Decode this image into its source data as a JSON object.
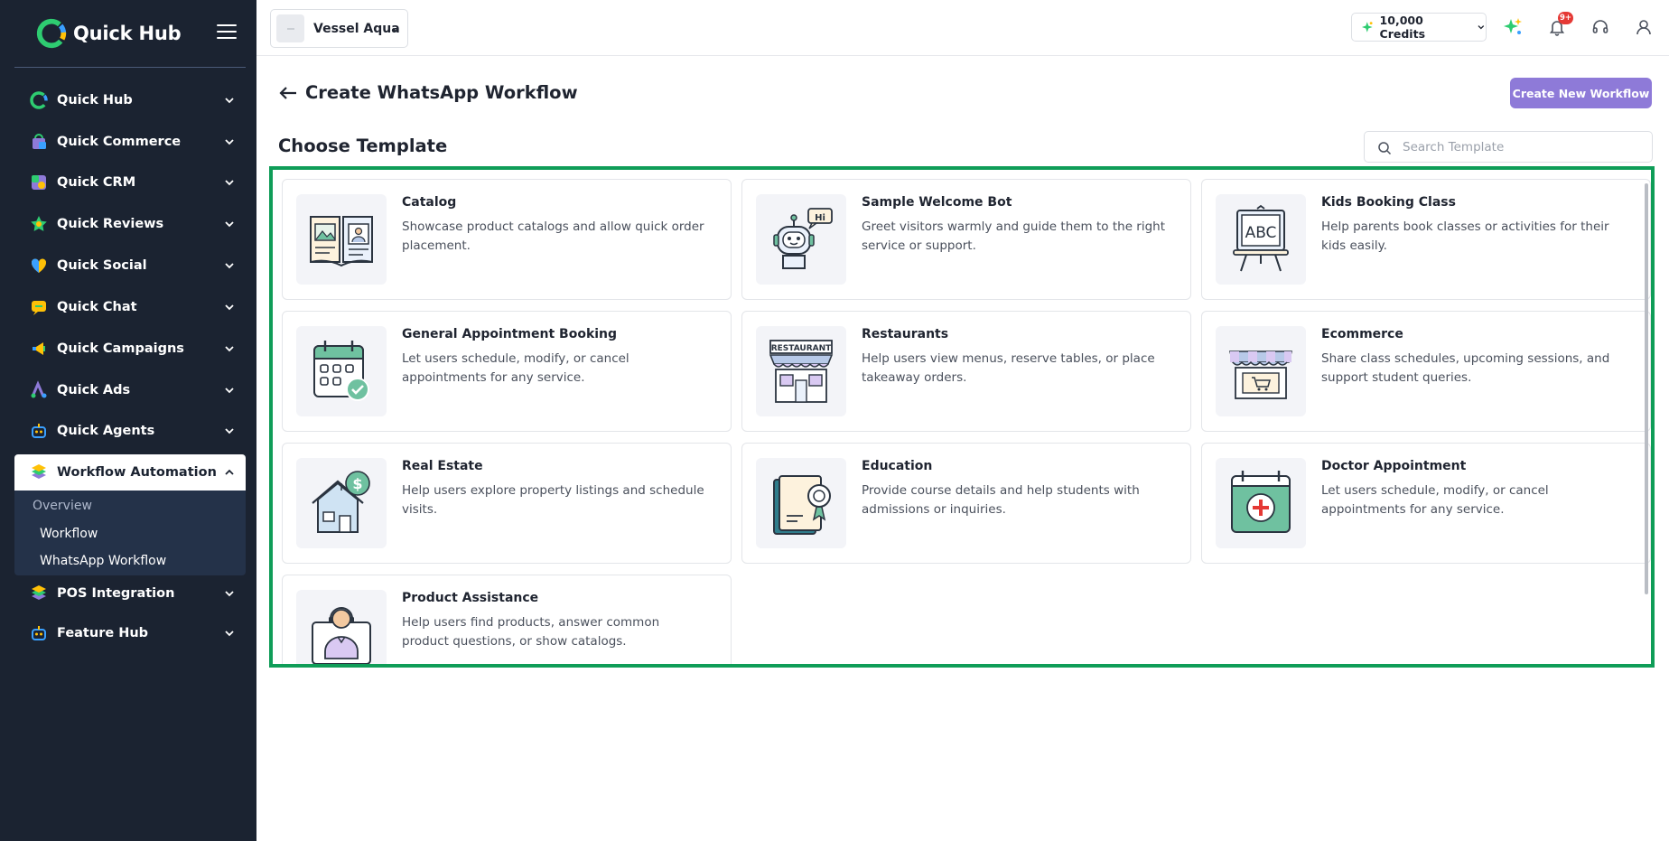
{
  "sidebar": {
    "brand": "Quick Hub",
    "items": [
      {
        "label": "Quick Hub",
        "icon": "quick-hub-icon"
      },
      {
        "label": "Quick Commerce",
        "icon": "shopping-bag-icon"
      },
      {
        "label": "Quick CRM",
        "icon": "crm-icon"
      },
      {
        "label": "Quick Reviews",
        "icon": "star-icon"
      },
      {
        "label": "Quick Social",
        "icon": "heart-icon"
      },
      {
        "label": "Quick Chat",
        "icon": "chat-icon"
      },
      {
        "label": "Quick Campaigns",
        "icon": "megaphone-icon"
      },
      {
        "label": "Quick Ads",
        "icon": "ads-icon"
      },
      {
        "label": "Quick Agents",
        "icon": "robot-icon"
      },
      {
        "label": "Workflow Automation",
        "icon": "workflow-icon",
        "active": true
      },
      {
        "label": "POS Integration",
        "icon": "pos-icon"
      },
      {
        "label": "Feature Hub",
        "icon": "feature-icon"
      }
    ],
    "submenu": [
      {
        "label": "Overview"
      },
      {
        "label": "Workflow"
      },
      {
        "label": "WhatsApp Workflow"
      }
    ]
  },
  "topbar": {
    "store_name": "Vessel Aqua",
    "credits": "10,000 Credits",
    "notification_count": "9+"
  },
  "main": {
    "title": "Create WhatsApp Workflow",
    "create_button": "Create New Workflow",
    "section_title": "Choose Template",
    "search_placeholder": "Search Template",
    "templates": [
      {
        "title": "Catalog",
        "description": "Showcase product catalogs and allow quick order placement.",
        "icon": "catalog-book-icon"
      },
      {
        "title": "Sample Welcome Bot",
        "description": "Greet visitors warmly and guide them to the right service or support.",
        "icon": "robot-hi-icon"
      },
      {
        "title": "Kids Booking Class",
        "description": "Help parents book classes or activities for their kids easily.",
        "icon": "abc-board-icon"
      },
      {
        "title": "General Appointment Booking",
        "description": "Let users schedule, modify, or cancel appointments for any service.",
        "icon": "calendar-check-icon"
      },
      {
        "title": "Restaurants",
        "description": "Help users view menus, reserve tables, or place takeaway orders.",
        "icon": "restaurant-icon"
      },
      {
        "title": "Ecommerce",
        "description": "Share class schedules, upcoming sessions, and support student queries.",
        "icon": "storefront-cart-icon"
      },
      {
        "title": "Real Estate",
        "description": "Help users explore property listings and schedule visits.",
        "icon": "house-dollar-icon"
      },
      {
        "title": "Education",
        "description": "Provide course details and help students with admissions or inquiries.",
        "icon": "certificate-book-icon"
      },
      {
        "title": "Doctor Appointment",
        "description": "Let users schedule, modify, or cancel appointments for any service.",
        "icon": "medical-calendar-icon"
      },
      {
        "title": "Product Assistance",
        "description": "Help users find products, answer common product questions, or show catalogs.",
        "icon": "support-agent-icon"
      }
    ]
  },
  "colors": {
    "sidebar_bg": "#1b2331",
    "accent_purple": "#8e7ad8",
    "frame_green": "#0f9d58",
    "badge_red": "#e53935"
  }
}
